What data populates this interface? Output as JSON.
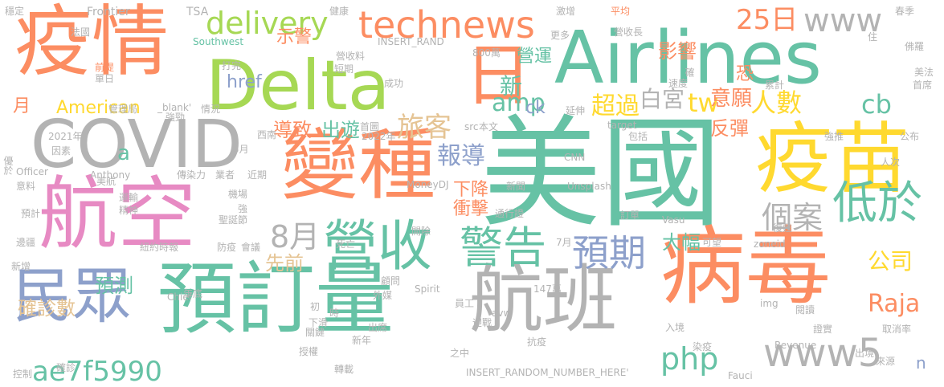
{
  "palette": {
    "teal": "#66c2a5",
    "orange": "#fc8d62",
    "blue": "#8da0cb",
    "pink": "#e78ac3",
    "green": "#a6d854",
    "yellow": "#ffd92f",
    "tan": "#e5c494",
    "gray": "#b3b3b3"
  },
  "words": [
    {
      "text": "美國",
      "color": "teal"
    },
    {
      "text": "Airlines",
      "color": "teal"
    },
    {
      "text": "Delta",
      "color": "green"
    },
    {
      "text": "疫情",
      "color": "orange"
    },
    {
      "text": "COVID",
      "color": "gray"
    },
    {
      "text": "變種",
      "color": "orange"
    },
    {
      "text": "航空",
      "color": "pink"
    },
    {
      "text": "疫苗",
      "color": "yellow"
    },
    {
      "text": "預訂量",
      "color": "teal"
    },
    {
      "text": "航班",
      "color": "gray"
    },
    {
      "text": "病毒",
      "color": "orange"
    },
    {
      "text": "民眾",
      "color": "blue"
    },
    {
      "text": "日",
      "color": "orange"
    },
    {
      "text": "technews",
      "color": "orange"
    },
    {
      "text": "delivery",
      "color": "green"
    },
    {
      "text": "營收",
      "color": "teal"
    },
    {
      "text": "警告",
      "color": "teal"
    },
    {
      "text": "預期",
      "color": "blue"
    },
    {
      "text": "www",
      "color": "gray"
    },
    {
      "text": "www5",
      "color": "gray"
    },
    {
      "text": "25日",
      "color": "orange"
    },
    {
      "text": "低於",
      "color": "teal"
    },
    {
      "text": "tw",
      "color": "yellow"
    },
    {
      "text": "人數",
      "color": "yellow"
    },
    {
      "text": "cb",
      "color": "teal"
    },
    {
      "text": "個案",
      "color": "gray"
    },
    {
      "text": "8月",
      "color": "gray"
    },
    {
      "text": "php",
      "color": "teal"
    },
    {
      "text": "Raja",
      "color": "orange"
    },
    {
      "text": "公司",
      "color": "yellow"
    },
    {
      "text": "ae7f5990",
      "color": "teal"
    },
    {
      "text": "超過",
      "color": "yellow"
    },
    {
      "text": "amp",
      "color": "teal"
    },
    {
      "text": "白宮",
      "color": "gray"
    },
    {
      "text": "意願",
      "color": "orange"
    },
    {
      "text": "反彈",
      "color": "orange"
    },
    {
      "text": "旅客",
      "color": "tan"
    },
    {
      "text": "報導",
      "color": "blue"
    },
    {
      "text": "新",
      "color": "teal"
    },
    {
      "text": "營運",
      "color": "teal"
    },
    {
      "text": "影響",
      "color": "orange"
    },
    {
      "text": "示警",
      "color": "orange"
    },
    {
      "text": "href",
      "color": "blue"
    },
    {
      "text": "American",
      "color": "yellow"
    },
    {
      "text": "導致",
      "color": "orange"
    },
    {
      "text": "出遊",
      "color": "teal"
    },
    {
      "text": "預測",
      "color": "teal"
    },
    {
      "text": "先前",
      "color": "tan"
    },
    {
      "text": "確診數",
      "color": "tan"
    },
    {
      "text": "大幅",
      "color": "teal"
    },
    {
      "text": "下降",
      "color": "orange"
    },
    {
      "text": "衝擊",
      "color": "orange"
    },
    {
      "text": "ck",
      "color": "blue"
    },
    {
      "text": "月",
      "color": "orange"
    },
    {
      "text": "a",
      "color": "teal"
    },
    {
      "text": "n",
      "color": "blue"
    },
    {
      "text": "恐",
      "color": "orange"
    },
    {
      "text": "穩定",
      "color": "gray"
    },
    {
      "text": "Frontier",
      "color": "gray"
    },
    {
      "text": "TSA",
      "color": "gray"
    },
    {
      "text": "健康",
      "color": "gray"
    },
    {
      "text": "激增",
      "color": "gray"
    },
    {
      "text": "平均",
      "color": "orange"
    },
    {
      "text": "春季",
      "color": "gray"
    },
    {
      "text": "法國",
      "color": "gray"
    },
    {
      "text": "Southwest",
      "color": "teal"
    },
    {
      "text": "INSERT_RAND",
      "color": "gray"
    },
    {
      "text": "營收長",
      "color": "gray"
    },
    {
      "text": "更多",
      "color": "gray"
    },
    {
      "text": "管理局",
      "color": "gray"
    },
    {
      "text": "_blank'",
      "color": "gray"
    },
    {
      "text": "成功",
      "color": "gray"
    },
    {
      "text": "800萬",
      "color": "gray"
    },
    {
      "text": "營收料",
      "color": "gray"
    },
    {
      "text": "速度",
      "color": "gray"
    },
    {
      "text": "確",
      "color": "gray"
    },
    {
      "text": "累計",
      "color": "gray"
    },
    {
      "text": "首席",
      "color": "gray"
    },
    {
      "text": "美法",
      "color": "gray"
    },
    {
      "text": "佛羅",
      "color": "gray"
    },
    {
      "text": "前提",
      "color": "orange"
    },
    {
      "text": "單日",
      "color": "gray"
    },
    {
      "text": "情況",
      "color": "gray"
    },
    {
      "text": "延伸",
      "color": "gray"
    },
    {
      "text": "強勁",
      "color": "gray"
    },
    {
      "text": "2021年",
      "color": "gray"
    },
    {
      "text": "2022年",
      "color": "gray"
    },
    {
      "text": "首圖",
      "color": "gray"
    },
    {
      "text": "src",
      "color": "gray"
    },
    {
      "text": "本文",
      "color": "gray"
    },
    {
      "text": "西南",
      "color": "gray"
    },
    {
      "text": "5月",
      "color": "gray"
    },
    {
      "text": "target",
      "color": "gray"
    },
    {
      "text": "強推",
      "color": "gray"
    },
    {
      "text": "公布",
      "color": "gray"
    },
    {
      "text": "包括",
      "color": "gray"
    },
    {
      "text": "因素",
      "color": "gray"
    },
    {
      "text": "Officer",
      "color": "gray"
    },
    {
      "text": "Anthony",
      "color": "gray"
    },
    {
      "text": "傳染力",
      "color": "gray"
    },
    {
      "text": "業者",
      "color": "gray"
    },
    {
      "text": "近期",
      "color": "gray"
    },
    {
      "text": "CNN",
      "color": "gray"
    },
    {
      "text": "人次",
      "color": "gray"
    },
    {
      "text": "優於",
      "color": "gray"
    },
    {
      "text": "美航",
      "color": "gray"
    },
    {
      "text": "意料",
      "color": "gray"
    },
    {
      "text": "MoneyDJ",
      "color": "gray"
    },
    {
      "text": "新聞",
      "color": "gray"
    },
    {
      "text": "Unsplash",
      "color": "gray"
    },
    {
      "text": "機場",
      "color": "gray"
    },
    {
      "text": "運輸",
      "color": "gray"
    },
    {
      "text": "精神",
      "color": "gray"
    },
    {
      "text": "強",
      "color": "gray"
    },
    {
      "text": "聖誕節",
      "color": "gray"
    },
    {
      "text": "通行證",
      "color": "gray"
    },
    {
      "text": "訂單",
      "color": "gray"
    },
    {
      "text": "Vasu",
      "color": "gray"
    },
    {
      "text": "預計",
      "color": "gray"
    },
    {
      "text": "紐約時報",
      "color": "gray"
    },
    {
      "text": "防疫",
      "color": "gray"
    },
    {
      "text": "會議",
      "color": "gray"
    },
    {
      "text": "開除",
      "color": "gray"
    },
    {
      "text": "死亡",
      "color": "gray"
    },
    {
      "text": "7月",
      "color": "gray"
    },
    {
      "text": "可望",
      "color": "gray"
    },
    {
      "text": "zoneid",
      "color": "gray"
    },
    {
      "text": "復甦",
      "color": "gray"
    },
    {
      "text": "邊疆",
      "color": "gray"
    },
    {
      "text": "新增",
      "color": "gray"
    },
    {
      "text": "Chief",
      "color": "gray"
    },
    {
      "text": "年底",
      "color": "gray"
    },
    {
      "text": "顧問",
      "color": "gray"
    },
    {
      "text": "Spirit",
      "color": "gray"
    },
    {
      "text": "147萬",
      "color": "gray"
    },
    {
      "text": "外媒",
      "color": "gray"
    },
    {
      "text": "員工",
      "color": "gray"
    },
    {
      "text": "img",
      "color": "gray"
    },
    {
      "text": "閱讀",
      "color": "gray"
    },
    {
      "text": "初",
      "color": "gray"
    },
    {
      "text": "時",
      "color": "gray"
    },
    {
      "text": "下滑",
      "color": "gray"
    },
    {
      "text": "關鍵",
      "color": "gray"
    },
    {
      "text": "迎戰",
      "color": "gray"
    },
    {
      "text": "avw",
      "color": "gray"
    },
    {
      "text": "抗疫",
      "color": "gray"
    },
    {
      "text": "染疫",
      "color": "gray"
    },
    {
      "text": "入境",
      "color": "gray"
    },
    {
      "text": "證實",
      "color": "gray"
    },
    {
      "text": "取消率",
      "color": "gray"
    },
    {
      "text": "出境",
      "color": "gray"
    },
    {
      "text": "來源",
      "color": "gray"
    },
    {
      "text": "授權",
      "color": "gray"
    },
    {
      "text": "出席",
      "color": "gray"
    },
    {
      "text": "新年",
      "color": "gray"
    },
    {
      "text": "之中",
      "color": "gray"
    },
    {
      "text": "Revenue",
      "color": "gray"
    },
    {
      "text": "Fauci",
      "color": "gray"
    },
    {
      "text": "控制",
      "color": "gray"
    },
    {
      "text": "確診",
      "color": "gray"
    },
    {
      "text": "轉載",
      "color": "gray"
    },
    {
      "text": "INSERT_RANDOM_NUMBER_HERE'",
      "color": "gray"
    },
    {
      "text": "打完",
      "color": "gray"
    },
    {
      "text": "短期",
      "color": "gray"
    },
    {
      "text": "住",
      "color": "gray"
    }
  ]
}
